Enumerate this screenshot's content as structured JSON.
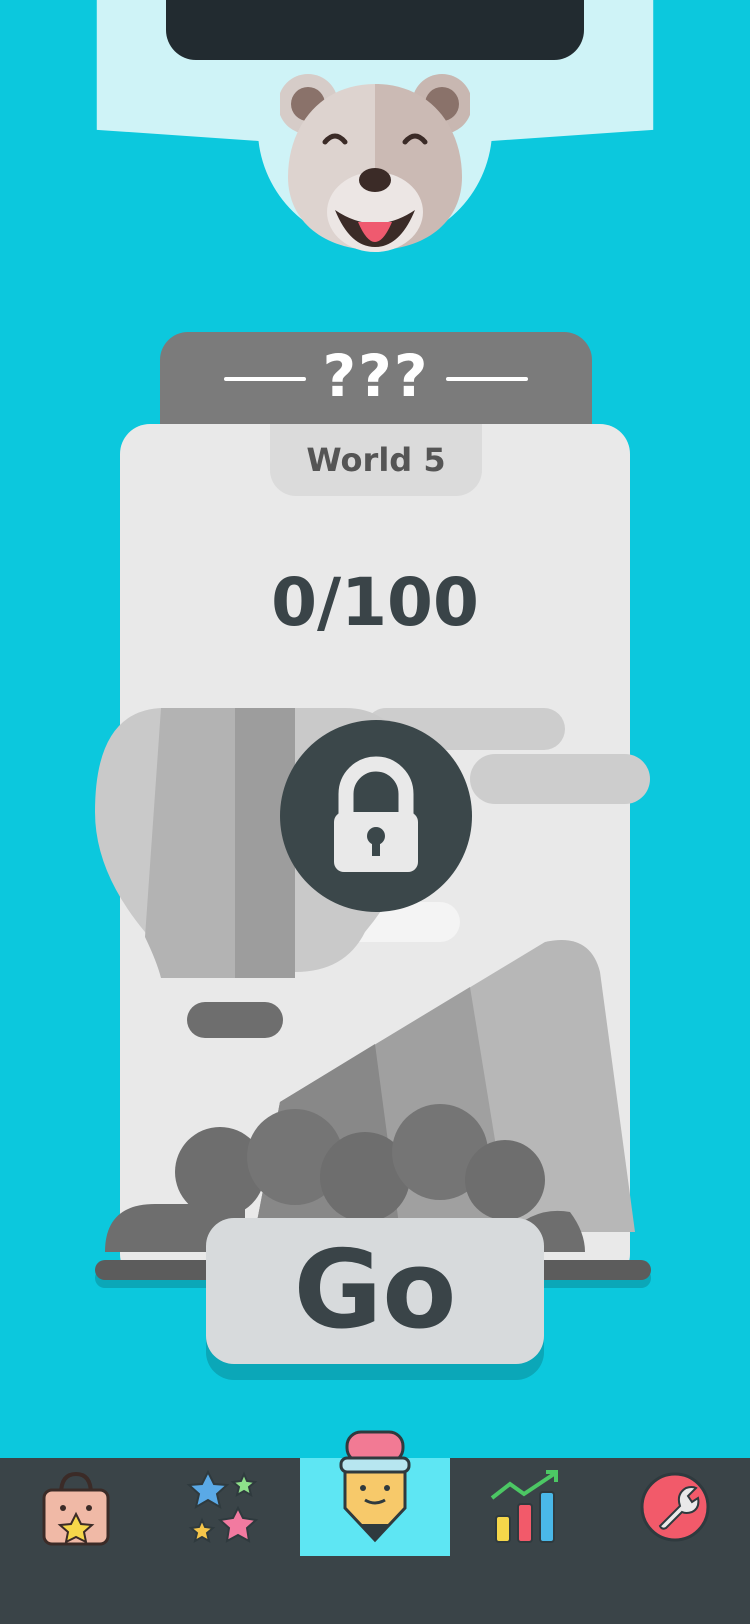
{
  "level_card": {
    "title": "???",
    "world_label": "World 5",
    "progress": "0/100",
    "locked": true
  },
  "go_button": {
    "label": "Go"
  },
  "bottom_nav": {
    "items": [
      {
        "name": "shop",
        "icon": "shopping-bag-icon",
        "active": false
      },
      {
        "name": "stickers",
        "icon": "stars-icon",
        "active": false
      },
      {
        "name": "play",
        "icon": "pencil-mascot-icon",
        "active": true
      },
      {
        "name": "stats",
        "icon": "chart-icon",
        "active": false
      },
      {
        "name": "settings",
        "icon": "wrench-icon",
        "active": false
      }
    ]
  },
  "colors": {
    "background": "#0cc8dd",
    "top_band": "#cff3f7",
    "card_header": "#7b7b7b",
    "card_body": "#e9e9e9",
    "lock": "#3b474a",
    "nav_bar": "#3a4448",
    "nav_active": "#5ee6f3"
  }
}
